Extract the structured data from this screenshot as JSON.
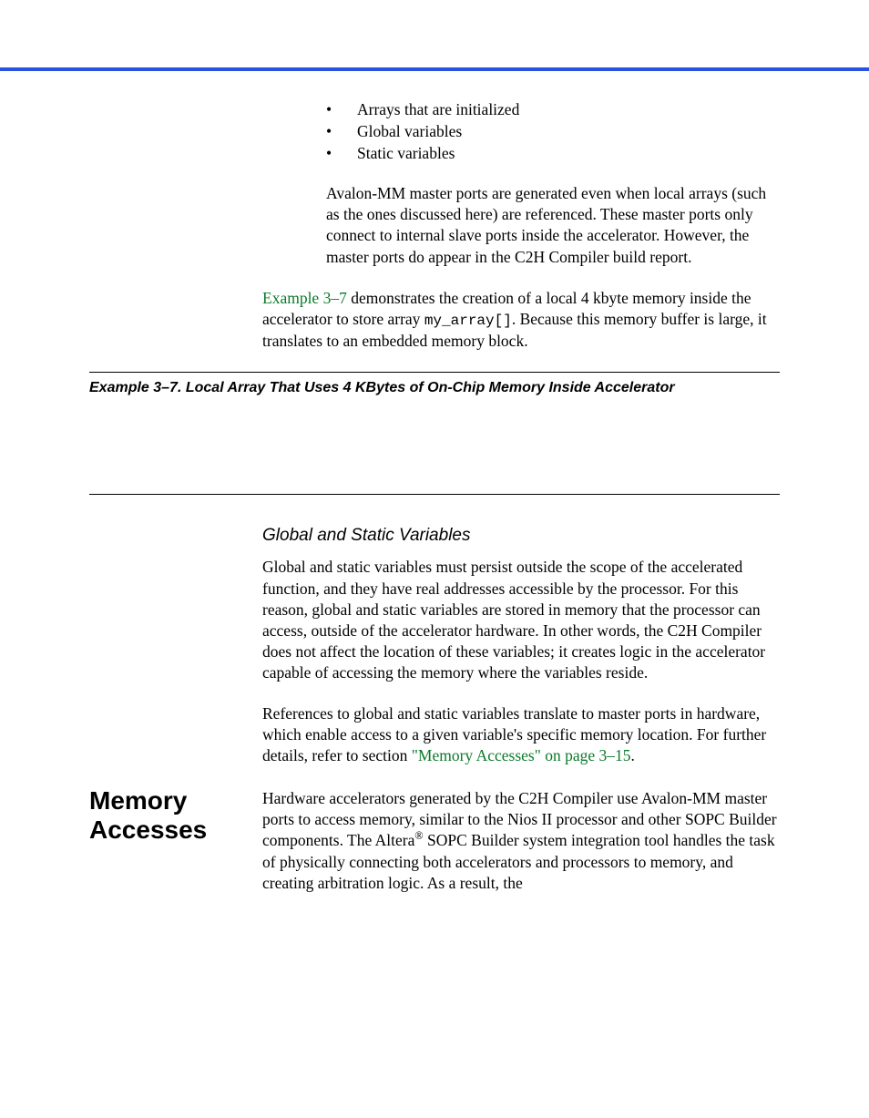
{
  "bullets": {
    "b1": "Arrays that are initialized",
    "b2": "Global variables",
    "b3": "Static variables"
  },
  "para_avalon": "Avalon-MM master ports are generated even when local arrays (such as the ones discussed here) are referenced. These master ports only connect to internal slave ports inside the accelerator. However, the master ports do appear in the C2H Compiler build report.",
  "para_example_lead": {
    "link": "Example 3–7",
    "mid1": " demonstrates the creation of a local 4 kbyte memory inside the accelerator to store array ",
    "code_inline": "my_array[]",
    "mid2": ". Because this memory buffer is large, it translates to an embedded memory block."
  },
  "example_caption": "Example 3–7. Local Array That Uses 4 KBytes of On-Chip Memory Inside Accelerator",
  "subheading_global_static": "Global and Static Variables",
  "para_global_static": "Global and static variables must persist outside the scope of the accelerated function, and they have real addresses accessible by the processor. For this reason, global and static variables are stored in memory that the processor can access, outside of the accelerator hardware. In other words, the C2H Compiler does not affect the location of these variables; it creates logic in the accelerator capable of accessing the memory where the variables reside.",
  "para_refs_global_static": {
    "text": "References to global and static variables translate to master ports in hardware, which enable access to a given variable's specific memory location. For further details, refer to section ",
    "link1": "\"Memory Accesses\" on page 3–15",
    "tail": "."
  },
  "side_heading": "Memory Accesses",
  "para_memory_accesses": {
    "before_reg": "Hardware accelerators generated by the C2H Compiler use Avalon-MM master ports to access memory, similar to the Nios II processor and other SOPC Builder components. The Altera",
    "after_reg": " SOPC Builder system integration tool handles the task of physically connecting both accelerators and processors to memory, and creating arbitration logic. As a result, the"
  }
}
